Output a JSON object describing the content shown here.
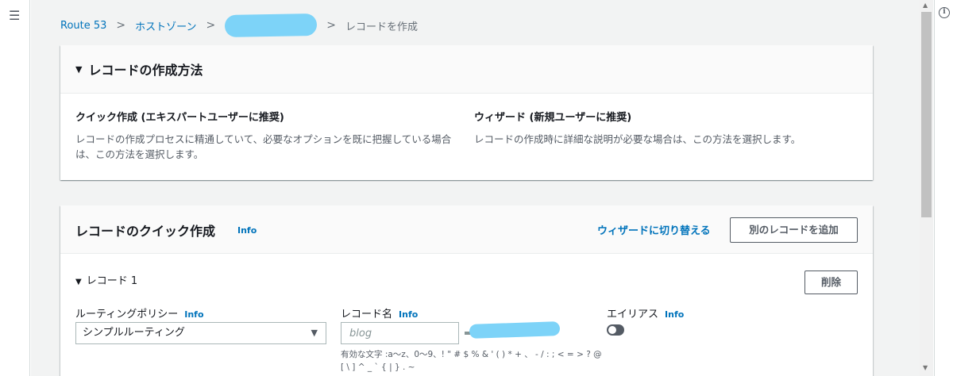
{
  "breadcrumb": {
    "route53": "Route 53",
    "hosted_zones": "ホストゾーン",
    "current": "レコードを作成"
  },
  "method_panel": {
    "title": "レコードの作成方法",
    "quick": {
      "title": "クイック作成 (エキスパートユーザーに推奨)",
      "description": "レコードの作成プロセスに精通していて、必要なオプションを既に把握している場合は、この方法を選択します。"
    },
    "wizard": {
      "title": "ウィザード (新規ユーザーに推奨)",
      "description": "レコードの作成時に詳細な説明が必要な場合は、この方法を選択します。"
    }
  },
  "quick_panel": {
    "title": "レコードのクイック作成",
    "info": "Info",
    "switch_wizard": "ウィザードに切り替える",
    "add_record": "別のレコードを追加"
  },
  "record": {
    "label": "レコード 1",
    "delete": "削除",
    "routing_policy": {
      "label": "ルーティングポリシー",
      "info": "Info",
      "value": "シンプルルーティング"
    },
    "record_name": {
      "label": "レコード名",
      "info": "Info",
      "placeholder": "blog",
      "hint": "有効な文字 :a〜z、0〜9、! \" # $ % & ' ( ) * + 、 - / : ; < = > ? @ [ \\ ] ^ _ ` { | } . ~"
    },
    "alias": {
      "label": "エイリアス",
      "info": "Info",
      "enabled": false
    }
  }
}
